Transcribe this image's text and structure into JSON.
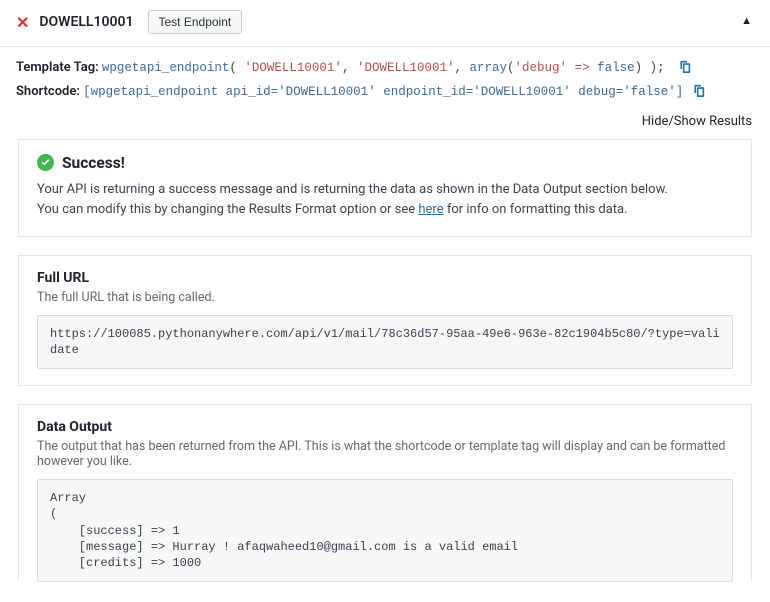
{
  "header": {
    "title": "DOWELL10001",
    "test_label": "Test Endpoint"
  },
  "tags": {
    "template_label": "Template Tag:",
    "template_fn": "wpgetapi_endpoint",
    "template_arg1": "'DOWELL10001'",
    "template_arg2": "'DOWELL10001'",
    "template_array_kw": "array",
    "template_array_key": "'debug'",
    "template_array_arrow": "=>",
    "template_array_val": "false",
    "shortcode_label": "Shortcode:",
    "shortcode_code": "[wpgetapi_endpoint api_id='DOWELL10001' endpoint_id='DOWELL10001' debug='false']"
  },
  "toggle_results": "Hide/Show Results",
  "success": {
    "title": "Success!",
    "desc1": "Your API is returning a success message and is returning the data as shown in the Data Output section below.",
    "desc2a": "You can modify this by changing the Results Format option or see ",
    "desc2_link": "here",
    "desc2b": " for info on formatting this data."
  },
  "full_url": {
    "title": "Full URL",
    "sub": "The full URL that is being called.",
    "value": "https://100085.pythonanywhere.com/api/v1/mail/78c36d57-95aa-49e6-963e-82c1904b5c80/?type=validate"
  },
  "data_output": {
    "title": "Data Output",
    "sub": "The output that has been returned from the API. This is what the shortcode or template tag will display and can be formatted however you like.",
    "raw": "Array\n(\n    [success] => 1\n    [message] => Hurray ! afaqwaheed10@gmail.com is a valid email\n    [credits] => 1000",
    "parsed": {
      "success": 1,
      "message": "Hurray ! afaqwaheed10@gmail.com is a valid email",
      "credits": 1000
    }
  }
}
